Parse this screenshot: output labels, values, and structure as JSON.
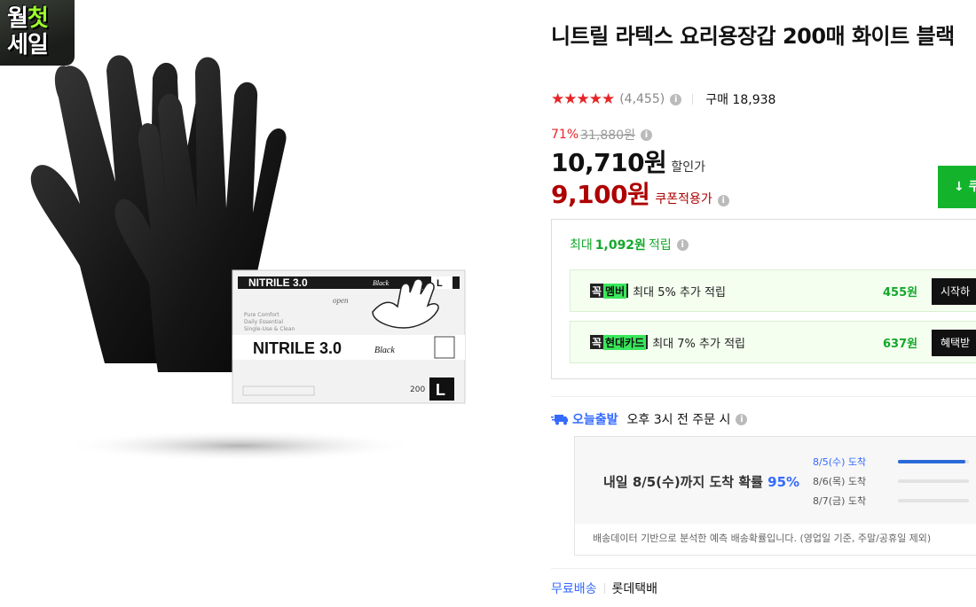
{
  "badge": {
    "line1_a": "월",
    "line1_b": "첫",
    "line2": "세일"
  },
  "product_image": {
    "box_brand": "NITRILE 3.0",
    "box_variant": "Black",
    "box_open": "open",
    "box_size": "L",
    "box_count": "200",
    "box_features": [
      "Pure Comfort",
      "Daily Essential",
      "Single-Use & Clean"
    ]
  },
  "product": {
    "title": "니트릴 라텍스 요리용장갑 200매 화이트 블랙",
    "stars": "★★★★★",
    "rating": 4.5,
    "review_count": "(4,455)",
    "purchase_count": "구매 18,938"
  },
  "price": {
    "discount_rate": "71%",
    "original": "31,880원",
    "sale": "10,710원",
    "sale_label": "할인가",
    "coupon": "9,100원",
    "coupon_label": "쿠폰적용가",
    "download_label": "↓ 쿠"
  },
  "rewards": {
    "title_prefix": "최대",
    "title_amount": "1,092원",
    "title_suffix": "적립",
    "items": [
      {
        "kkok": "꼭",
        "brand": "멤버",
        "desc": "최대 5% 추가 적립",
        "amount": "455원",
        "button": "시작하"
      },
      {
        "kkok": "꼭",
        "brand": "현대카드",
        "desc": "최대 7% 추가 적립",
        "amount": "637원",
        "button": "혜택받"
      }
    ]
  },
  "delivery": {
    "today_label": "오늘출발",
    "condition": "오후 3시 전 주문 시",
    "headline_prefix": "내일 8/5(수)까지 도착 확률",
    "headline_pct": "95%",
    "eta": [
      {
        "label": "8/5(수) 도착",
        "probability": 0.95
      },
      {
        "label": "8/6(목) 도착",
        "probability": 0.0
      },
      {
        "label": "8/7(금) 도착",
        "probability": 0.0
      }
    ],
    "note": "배송데이터 기반으로 분석한 예측 배송확률입니다. (영업일 기준, 주말/공휴일 제외)"
  },
  "shipping": {
    "free": "무료배송",
    "carrier": "롯데택배"
  },
  "colors": {
    "accent_red": "#e52528",
    "coupon_red": "#ae0000",
    "green": "#13b42c",
    "blue": "#346aff"
  }
}
